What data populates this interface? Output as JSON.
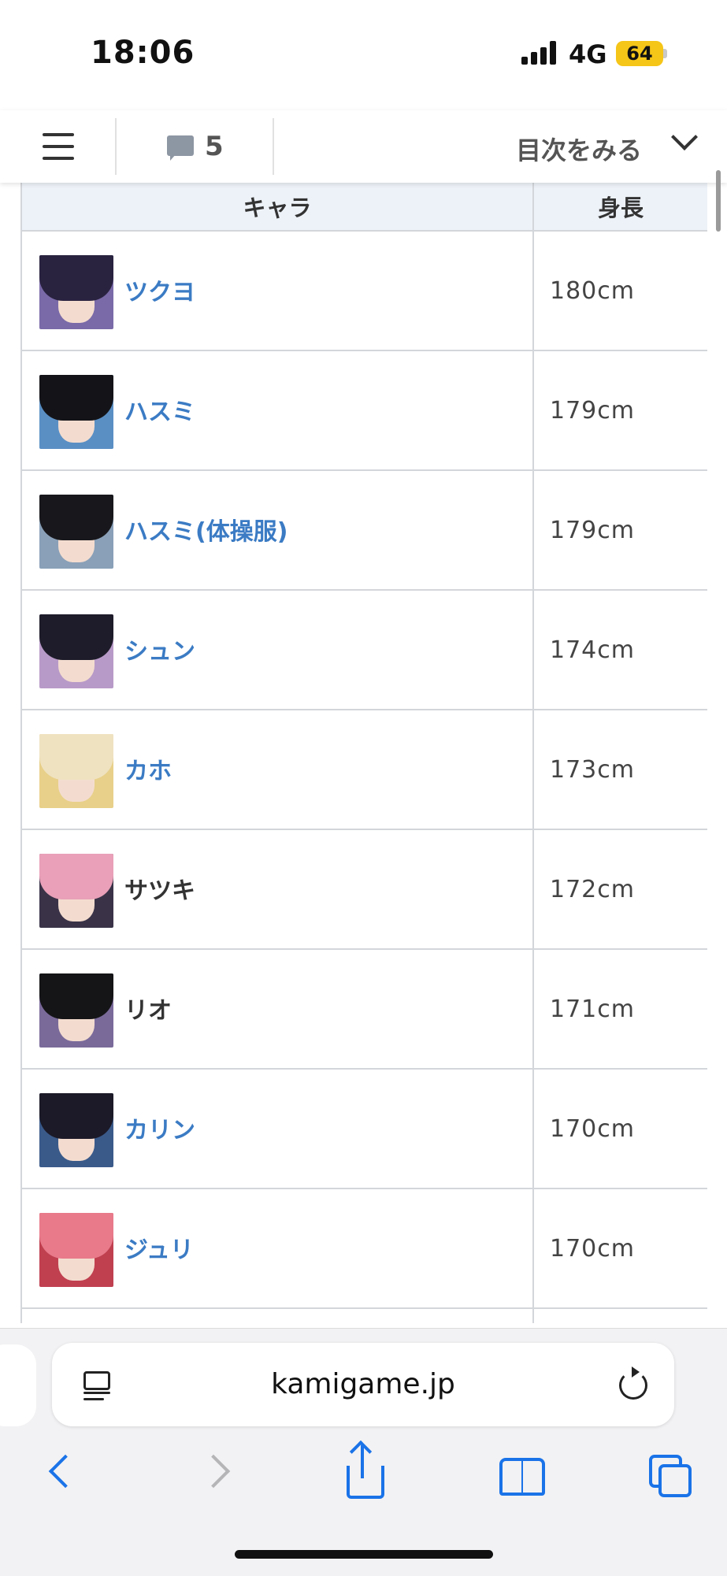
{
  "status_bar": {
    "time": "18:06",
    "network": "4G",
    "battery": "64"
  },
  "header": {
    "comment_count": "5",
    "toc_label": "目次をみる"
  },
  "table": {
    "columns": [
      "キャラ",
      "身長"
    ],
    "rows": [
      {
        "name": "ツクヨ",
        "height": "180cm",
        "link": true,
        "hair": "#2a2340",
        "bg": "#7a6aa8"
      },
      {
        "name": "ハスミ",
        "height": "179cm",
        "link": true,
        "hair": "#141418",
        "bg": "#5a8fc4"
      },
      {
        "name": "ハスミ(体操服)",
        "height": "179cm",
        "link": true,
        "hair": "#18181c",
        "bg": "#8aa0b8"
      },
      {
        "name": "シュン",
        "height": "174cm",
        "link": true,
        "hair": "#1e1c2a",
        "bg": "#b89ac8"
      },
      {
        "name": "カホ",
        "height": "173cm",
        "link": true,
        "hair": "#efe2c0",
        "bg": "#e8d08a"
      },
      {
        "name": "サツキ",
        "height": "172cm",
        "link": false,
        "hair": "#e9a0b8",
        "bg": "#3a3348"
      },
      {
        "name": "リオ",
        "height": "171cm",
        "link": false,
        "hair": "#151517",
        "bg": "#7a6a9a"
      },
      {
        "name": "カリン",
        "height": "170cm",
        "link": true,
        "hair": "#1c1a28",
        "bg": "#3a5a8a"
      },
      {
        "name": "ジュリ",
        "height": "170cm",
        "link": true,
        "hair": "#e87a8a",
        "bg": "#c04050"
      }
    ]
  },
  "browser": {
    "url": "kamigame.jp"
  },
  "colors": {
    "link": "#3b7bc4",
    "accent": "#1a73e8",
    "header_bg": "#edf2f8"
  }
}
